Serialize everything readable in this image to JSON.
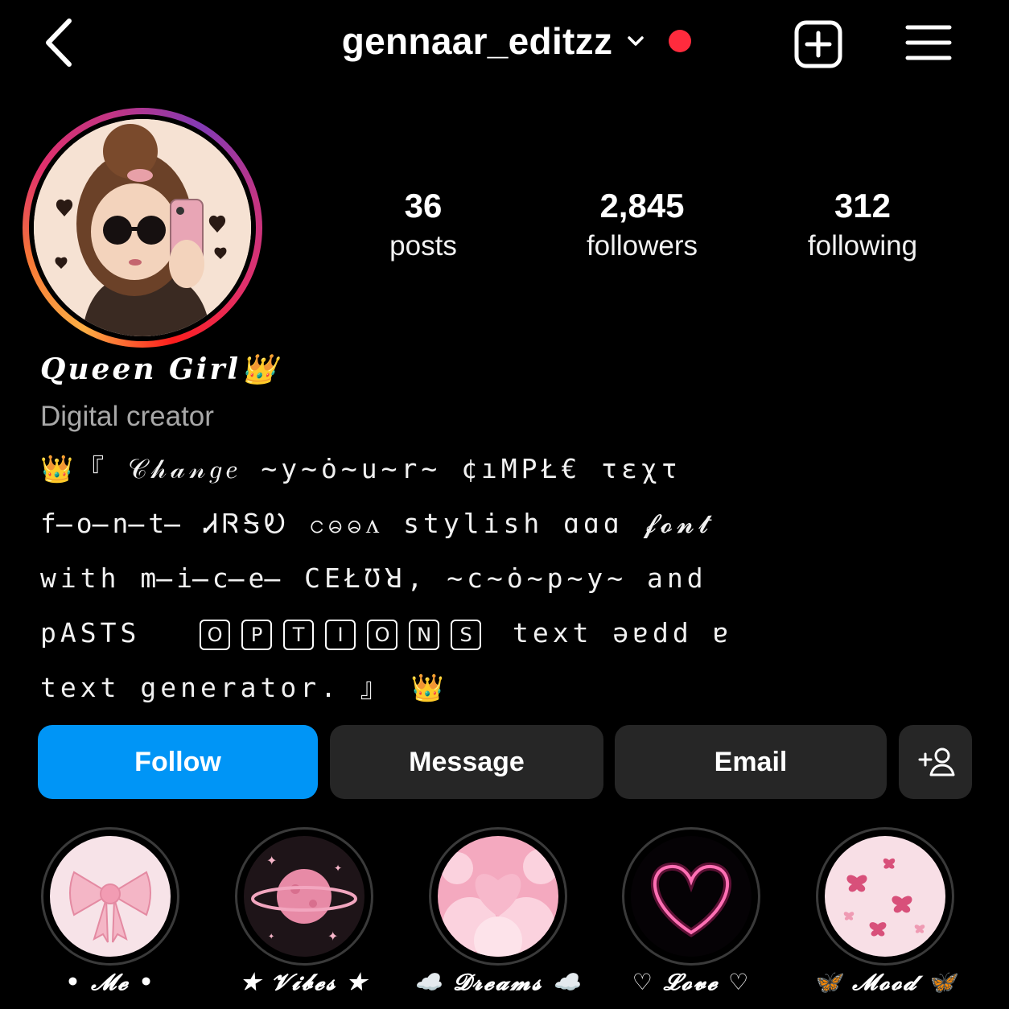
{
  "header": {
    "username": "gennaar_editzz",
    "live_dot_color": "#ff2b3d",
    "icons": [
      "back-chevron-icon",
      "chevron-down-icon",
      "plus-square-icon",
      "hamburger-menu-icon"
    ]
  },
  "stats": [
    {
      "value": "36",
      "label": "posts"
    },
    {
      "value": "2,845",
      "label": "followers"
    },
    {
      "value": "312",
      "label": "following"
    }
  ],
  "profile": {
    "display_name": "Queen Girl👑",
    "category": "Digital creator",
    "bio_lines": [
      "👑『 𝒞𝒽𝒶𝓃𝑔𝑒 ~y~ȯ~u~r~ ¢ıMPŁ€ τεχτ",
      "f̶o̶n̶t̶ ᏗᏒᎦᎧ ငဓဓᴧ stylish ɑɑɑ 𝓯𝓸𝓷𝓽",
      "with m̶i̶c̶e̶ CΕŁƱꓤ, ~c~ȯ~p~y~ and",
      "pASTS",
      "text generator. 』 👑"
    ],
    "bio_line4_boxed": [
      "O",
      "P",
      "T",
      "I",
      "O",
      "N",
      "S"
    ],
    "bio_line4_tail": "text ǝɐdd ɐ"
  },
  "actions": {
    "follow": "Follow",
    "message": "Message",
    "email": "Email",
    "add_user_icon": "add-user-icon",
    "follow_color": "#0095f6"
  },
  "highlights": [
    {
      "label": "• 𝓜𝓮 •",
      "icon": "pink-bow"
    },
    {
      "label": "★ 𝓥𝓲𝓫𝓮𝓼 ★",
      "icon": "pink-planet"
    },
    {
      "label": "☁️ 𝓓𝓻𝓮𝓪𝓶𝓼 ☁️",
      "icon": "pink-clouds-heart"
    },
    {
      "label": "♡ 𝓛𝓸𝓿𝓮 ♡",
      "icon": "neon-heart"
    },
    {
      "label": "🦋 𝓜𝓸𝓸𝓭 🦋",
      "icon": "butterflies"
    }
  ]
}
